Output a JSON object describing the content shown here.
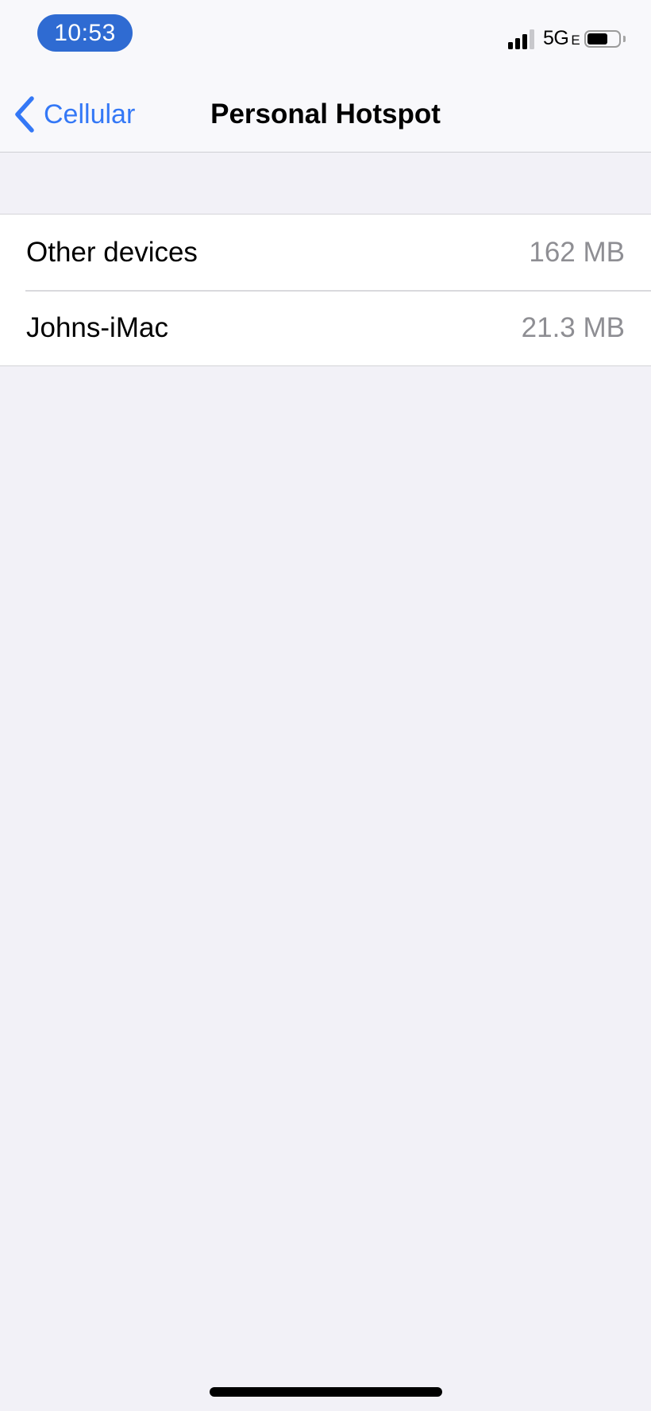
{
  "status_bar": {
    "time": "10:53",
    "network": "5G",
    "network_suffix": "E",
    "signal_bars_active": 3,
    "signal_bars_total": 4,
    "battery_level": 0.65,
    "time_pill_color": "#2F6BD2"
  },
  "nav": {
    "back_label": "Cellular",
    "title": "Personal Hotspot",
    "accent_color": "#3478F6"
  },
  "devices": [
    {
      "name": "Other devices",
      "usage": "162 MB"
    },
    {
      "name": "Johns-iMac",
      "usage": "21.3 MB"
    }
  ]
}
